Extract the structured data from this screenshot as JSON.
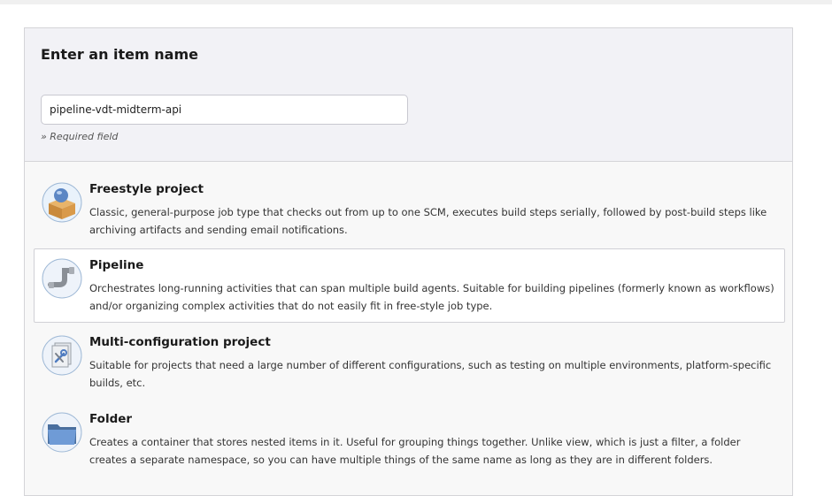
{
  "form": {
    "title": "Enter an item name",
    "item_name_value": "pipeline-vdt-midterm-api",
    "required_hint": "» Required field"
  },
  "item_types": [
    {
      "title": "Freestyle project",
      "description": "Classic, general-purpose job type that checks out from up to one SCM, executes build steps serially, followed by post-build steps like archiving artifacts and sending email notifications.",
      "icon": "freestyle-project-icon"
    },
    {
      "title": "Pipeline",
      "description": "Orchestrates long-running activities that can span multiple build agents. Suitable for building pipelines (formerly known as workflows) and/or organizing complex activities that do not easily fit in free-style job type.",
      "icon": "pipeline-icon"
    },
    {
      "title": "Multi-configuration project",
      "description": "Suitable for projects that need a large number of different configurations, such as testing on multiple environments, platform-specific builds, etc.",
      "icon": "multi-configuration-project-icon"
    },
    {
      "title": "Folder",
      "description": "Creates a container that stores nested items in it. Useful for grouping things together. Unlike view, which is just a filter, a folder creates a separate namespace, so you can have multiple things of the same name as long as they are in different folders.",
      "icon": "folder-icon"
    }
  ],
  "selected_item": "Pipeline"
}
